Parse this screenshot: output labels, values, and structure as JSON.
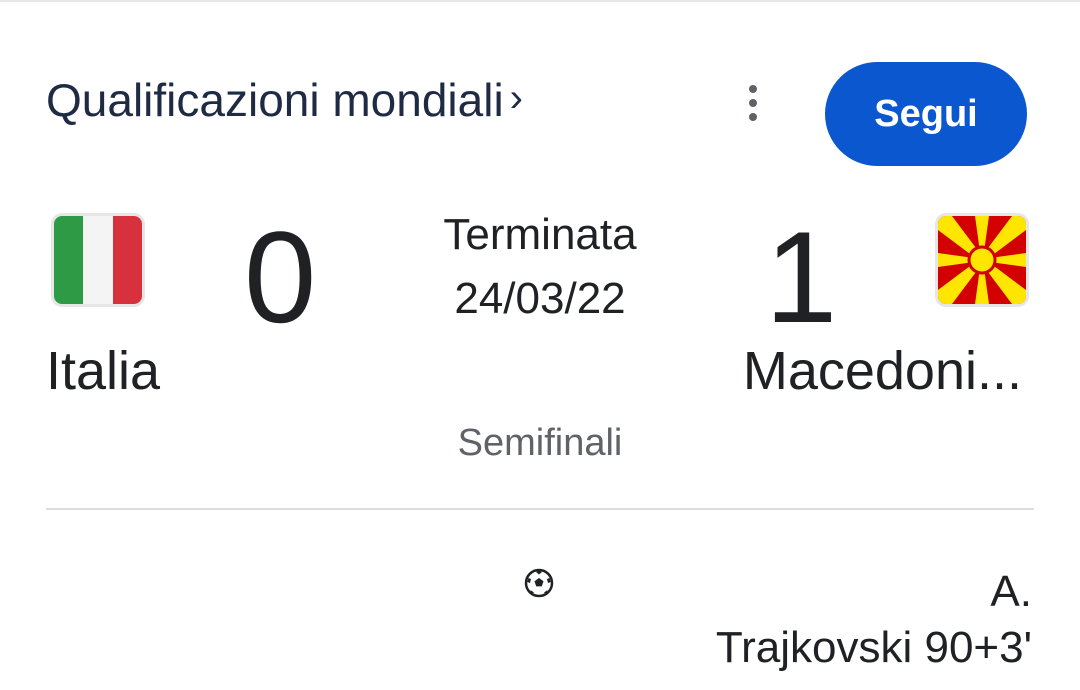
{
  "header": {
    "competition": "Qualificazioni mondiali",
    "chevron": "›",
    "follow_label": "Segui",
    "accent_color": "#0b57d0"
  },
  "match": {
    "status": "Terminata",
    "date": "24/03/22",
    "round": "Semifinali",
    "home": {
      "name": "Italia",
      "score": "0",
      "flag_icon": "italy-flag-icon"
    },
    "away": {
      "name": "Macedoni...",
      "score": "1",
      "flag_icon": "north-macedonia-flag-icon"
    }
  },
  "goals": {
    "icon": "soccer-ball-icon",
    "away_scorer_line1": "A.",
    "away_scorer_line2": "Trajkovski 90+3'"
  }
}
